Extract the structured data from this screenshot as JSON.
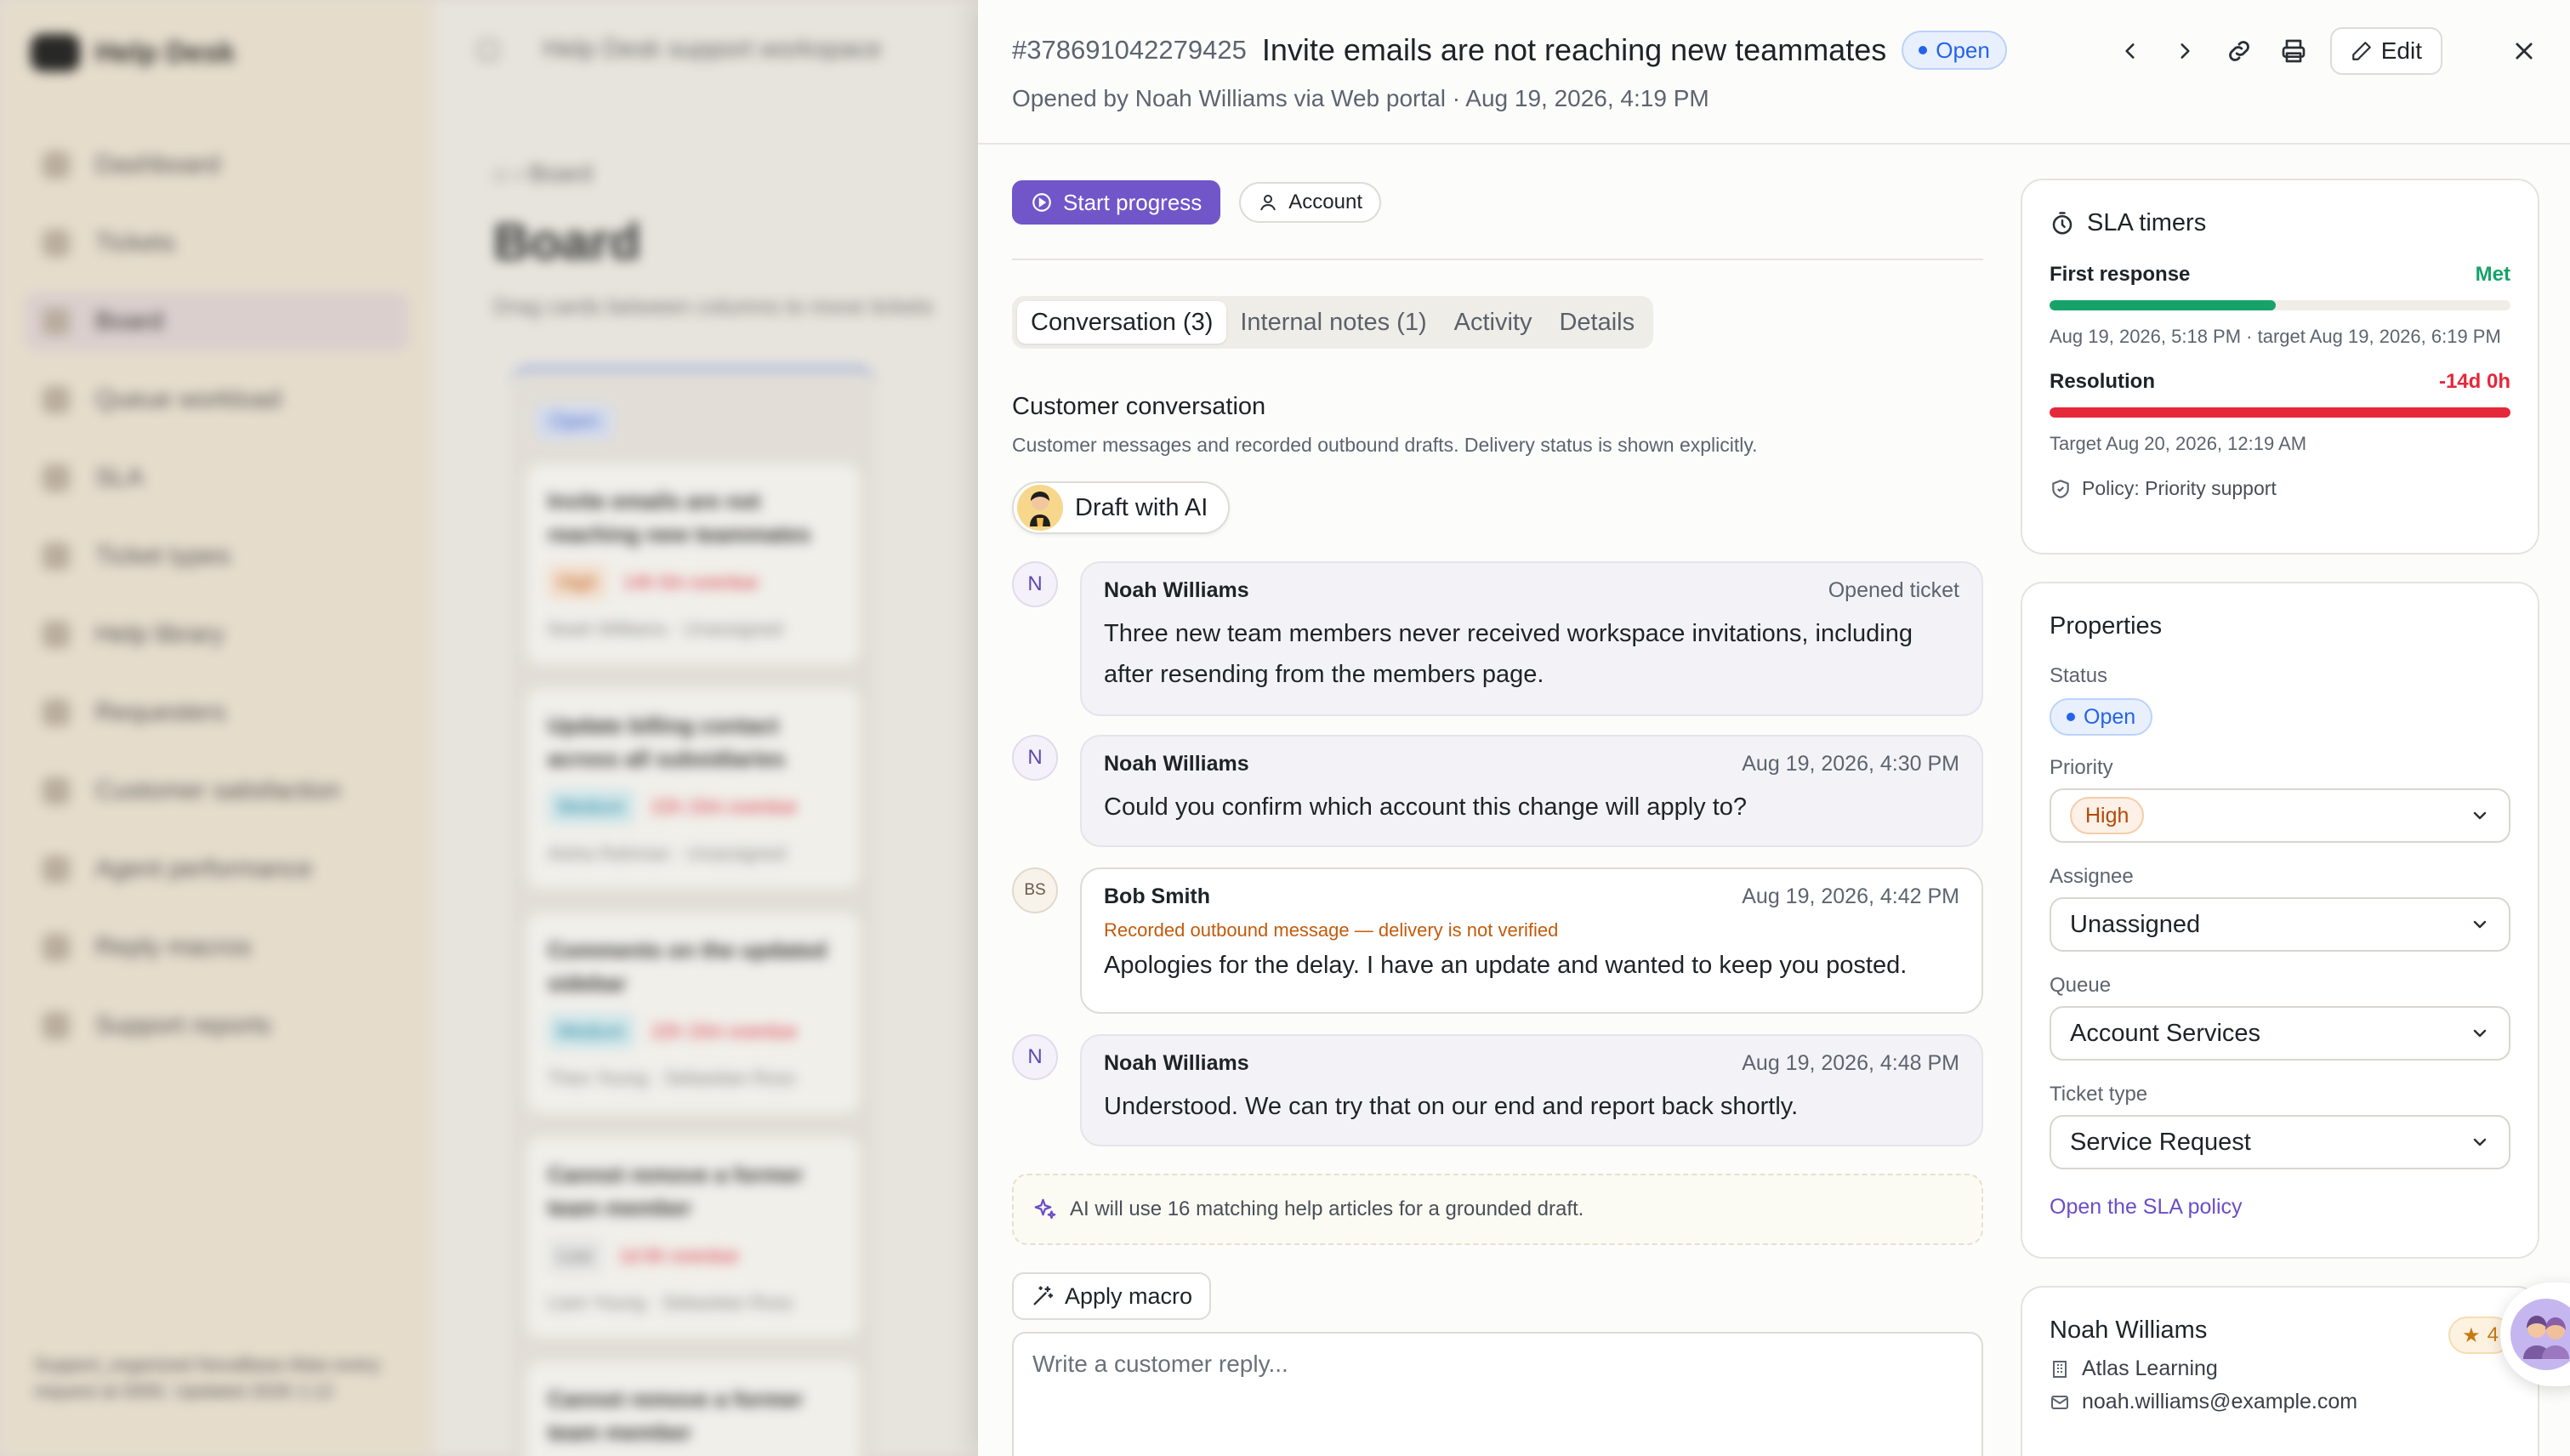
{
  "background": {
    "brand": "Help Desk",
    "workspace": "Help Desk support workspace",
    "nav": [
      "Dashboard",
      "Tickets",
      "Board",
      "Queue workload",
      "SLA",
      "Ticket types",
      "Help library",
      "Requesters",
      "Customer satisfaction",
      "Agent performance",
      "Reply macros",
      "Support reports"
    ],
    "nav_active": "Board",
    "account": "Support_organized NovaBase Atlas every request at 0000. Updated 2026 1:12",
    "breadcrumb": "Board",
    "page_title": "Board",
    "page_desc": "Drag cards between columns to move tickets",
    "column_label": "Open",
    "cards": [
      {
        "title": "Invite emails are not reaching new teammates",
        "priority": "High",
        "sla": "14h 0m overdue",
        "requester": "Noah Williams",
        "assignee": "Unassigned"
      },
      {
        "title": "Update billing contact across all subsidiaries",
        "priority": "Medium",
        "sla": "22h 15m overdue",
        "requester": "Aisha Rahman",
        "assignee": "Unassigned"
      },
      {
        "title": "Comments on the updated sidebar",
        "priority": "Medium",
        "sla": "22h 15m overdue",
        "requester": "Theo Young",
        "assignee": "Sebastian Ross"
      },
      {
        "title": "Cannot remove a former team member",
        "priority": "Low",
        "sla": "1d 6h overdue",
        "requester": "Liam Young",
        "assignee": "Sebastian Ross"
      },
      {
        "title": "Cannot remove a former team member",
        "priority": "",
        "sla": "",
        "requester": "",
        "assignee": ""
      }
    ]
  },
  "ticket": {
    "id": "#378691042279425",
    "title": "Invite emails are not reaching new teammates",
    "status": "Open",
    "opened_line": "Opened by Noah Williams via Web portal · Aug 19, 2026, 4:19 PM",
    "edit_label": "Edit"
  },
  "actions": {
    "start_progress": "Start progress",
    "account": "Account"
  },
  "tabs": [
    {
      "label": "Conversation (3)",
      "active": true
    },
    {
      "label": "Internal notes (1)",
      "active": false
    },
    {
      "label": "Activity",
      "active": false
    },
    {
      "label": "Details",
      "active": false
    }
  ],
  "conversation": {
    "title": "Customer conversation",
    "description": "Customer messages and recorded outbound drafts. Delivery status is shown explicitly.",
    "draft_ai_label": "Draft with AI",
    "messages": [
      {
        "initials": "N",
        "author": "Noah Williams",
        "stamp": "Opened ticket",
        "warning": "",
        "body": "Three new team members never received workspace invitations, including after resending from the members page."
      },
      {
        "initials": "N",
        "author": "Noah Williams",
        "stamp": "Aug 19, 2026, 4:30 PM",
        "warning": "",
        "body": "Could you confirm which account this change will apply to?"
      },
      {
        "initials": "BS",
        "author": "Bob Smith",
        "stamp": "Aug 19, 2026, 4:42 PM",
        "warning": "Recorded outbound message — delivery is not verified",
        "body": "Apologies for the delay. I have an update and wanted to keep you posted."
      },
      {
        "initials": "N",
        "author": "Noah Williams",
        "stamp": "Aug 19, 2026, 4:48 PM",
        "warning": "",
        "body": "Understood. We can try that on our end and report back shortly."
      }
    ],
    "ai_note": "AI will use 16 matching help articles for a grounded draft.",
    "apply_macro": "Apply macro",
    "reply_placeholder": "Write a customer reply..."
  },
  "sla": {
    "title": "SLA timers",
    "first_response": {
      "label": "First response",
      "status": "Met",
      "progress": 0.49,
      "detail": "Aug 19, 2026, 5:18 PM · target Aug 19, 2026, 6:19 PM"
    },
    "resolution": {
      "label": "Resolution",
      "status": "-14d 0h",
      "progress": 1.0,
      "detail": "Target Aug 20, 2026, 12:19 AM"
    },
    "policy": "Policy: Priority support",
    "colors": {
      "met": "#16a36a",
      "breached": "#e5283a"
    }
  },
  "properties": {
    "title": "Properties",
    "status_label": "Status",
    "status_value": "Open",
    "priority_label": "Priority",
    "priority_value": "High",
    "assignee_label": "Assignee",
    "assignee_value": "Unassigned",
    "queue_label": "Queue",
    "queue_value": "Account Services",
    "type_label": "Ticket type",
    "type_value": "Service Request",
    "sla_link": "Open the SLA policy"
  },
  "requester": {
    "name": "Noah Williams",
    "company": "Atlas Learning",
    "email": "noah.williams@example.com",
    "rating": "4"
  },
  "colors": {
    "accent": "#7056c9",
    "open_blue": "#2563eb",
    "warning_orange": "#c25b0c"
  }
}
